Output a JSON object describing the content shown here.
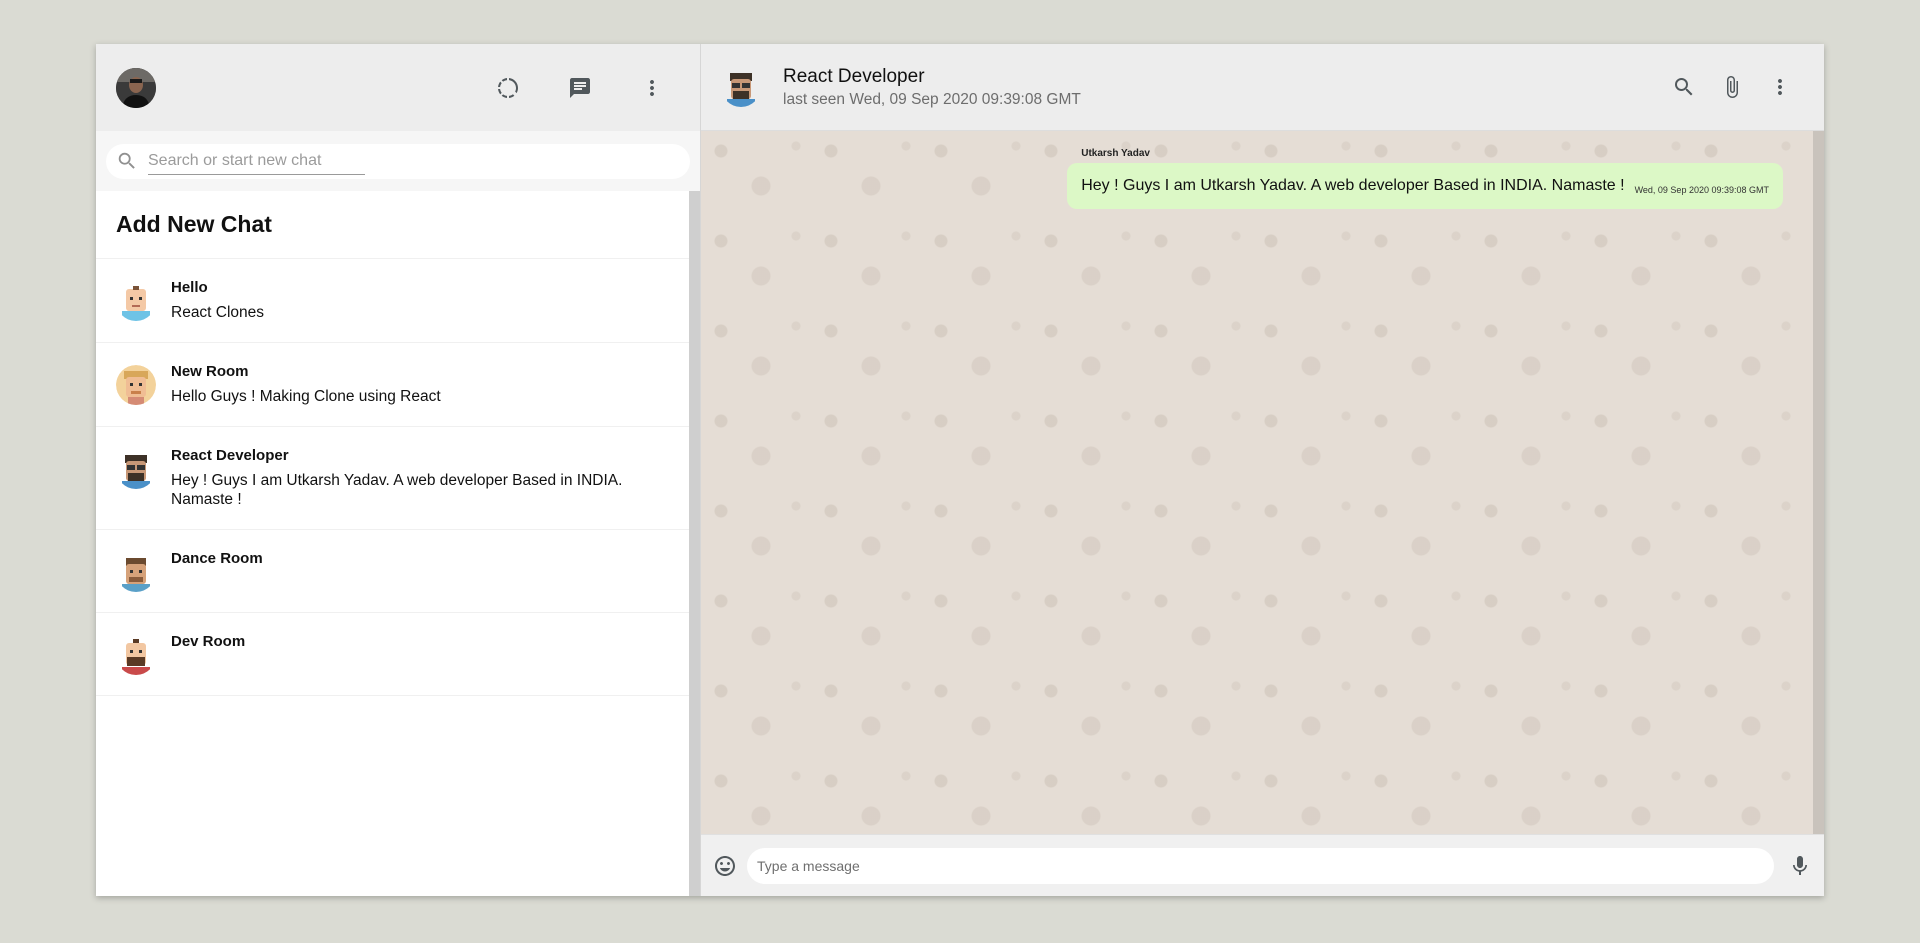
{
  "sidebar": {
    "user_avatar": "profile-photo",
    "icons": [
      "status-icon",
      "chat-icon",
      "more-vert-icon"
    ],
    "search": {
      "placeholder": "Search or start new chat",
      "value": ""
    },
    "add_chat_label": "Add New Chat",
    "chats": [
      {
        "name": "Hello",
        "last_message": "React Clones",
        "avatar": "avatar-bald"
      },
      {
        "name": "New Room",
        "last_message": "Hello Guys ! Making Clone using React",
        "avatar": "avatar-blonde"
      },
      {
        "name": "React Developer",
        "last_message": "Hey ! Guys I am Utkarsh Yadav. A web developer Based in INDIA. Namaste !",
        "avatar": "avatar-glasses"
      },
      {
        "name": "Dance Room",
        "last_message": "",
        "avatar": "avatar-brown"
      },
      {
        "name": "Dev Room",
        "last_message": "",
        "avatar": "avatar-beard"
      }
    ]
  },
  "main": {
    "header": {
      "name": "React Developer",
      "last_seen": "last seen Wed, 09 Sep 2020 09:39:08 GMT",
      "icons": [
        "search-icon",
        "attach-icon",
        "more-vert-icon"
      ]
    },
    "messages": [
      {
        "sender": "Utkarsh Yadav",
        "text": "Hey ! Guys I am Utkarsh Yadav. A web developer Based in INDIA. Namaste !",
        "timestamp": "Wed, 09 Sep 2020 09:39:08 GMT"
      }
    ],
    "footer": {
      "placeholder": "Type a message",
      "value": ""
    }
  },
  "colors": {
    "header_bg": "#ededed",
    "chat_bg": "#e5ddd5",
    "sent_bubble": "#dcf8c6",
    "icon": "#51585c"
  }
}
